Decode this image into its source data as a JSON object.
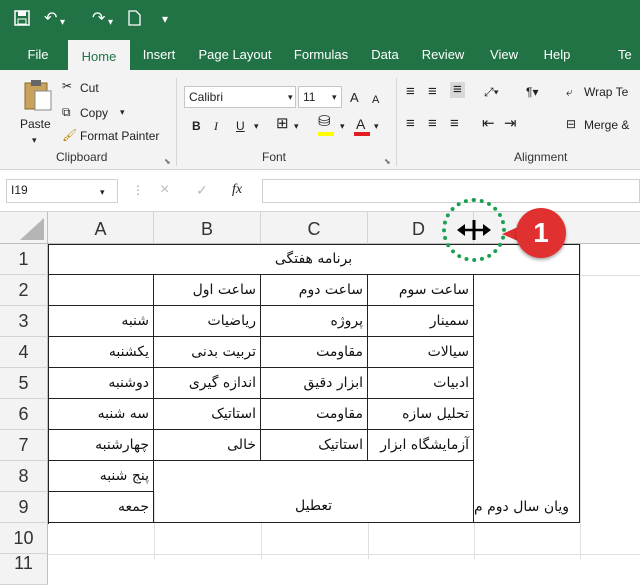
{
  "quick_access": {
    "save_icon": "save-icon",
    "undo_icon": "undo-icon",
    "redo_icon": "redo-icon",
    "new_icon": "new-document-icon",
    "customize_icon": "customize-icon"
  },
  "tabs": [
    "File",
    "Home",
    "Insert",
    "Page Layout",
    "Formulas",
    "Data",
    "Review",
    "View",
    "Help",
    "Te"
  ],
  "clipboard": {
    "paste": "Paste",
    "cut": "Cut",
    "copy": "Copy",
    "format_painter": "Format Painter",
    "label": "Clipboard"
  },
  "font": {
    "name": "Calibri",
    "size": "11",
    "bold": "B",
    "italic": "I",
    "underline": "U",
    "grow": "A",
    "shrink": "A",
    "fill_letter": "A",
    "label": "Font"
  },
  "alignment": {
    "wrap_text": "Wrap Te",
    "merge": "Merge &",
    "label": "Alignment"
  },
  "formula_bar": {
    "name_box": "I19",
    "cancel": "×",
    "enter": "✓",
    "fx": "fx",
    "value": ""
  },
  "columns": [
    "A",
    "B",
    "C",
    "D"
  ],
  "rows": [
    "1",
    "2",
    "3",
    "4",
    "5",
    "6",
    "7",
    "8",
    "9",
    "10",
    "11"
  ],
  "cells": {
    "title": "برنامه هفتگی",
    "r2": {
      "B": "ساعت اول",
      "C": "ساعت دوم",
      "D": "ساعت سوم"
    },
    "r3": {
      "A": "شنبه",
      "B": "ریاضیات",
      "C": "پروژه",
      "D": "سمینار"
    },
    "r4": {
      "A": "یکشنبه",
      "B": "تربیت بدنی",
      "C": "مقاومت",
      "D": "سیالات"
    },
    "r5": {
      "A": "دوشنبه",
      "B": "اندازه گیری",
      "C": "ابزار دقیق",
      "D": "ادبیات"
    },
    "r6": {
      "A": "سه شنبه",
      "B": "استاتیک",
      "C": "مقاومت",
      "D": "تحلیل سازه"
    },
    "r7": {
      "A": "چهارشنبه",
      "B": "خالی",
      "C": "استاتیک",
      "D": "آزمایشگاه ابزار"
    },
    "r8": {
      "A": "پنج شنبه"
    },
    "r9": {
      "A": "جمعه",
      "BC": "تعطیل",
      "E": "ویان سال دوم م"
    }
  },
  "annotation": {
    "number": "1",
    "cursor_icon": "resize-column-cursor-icon"
  },
  "colors": {
    "excel_green": "#217346",
    "badge_red": "#e03030",
    "dotted_green": "#1aa050"
  }
}
